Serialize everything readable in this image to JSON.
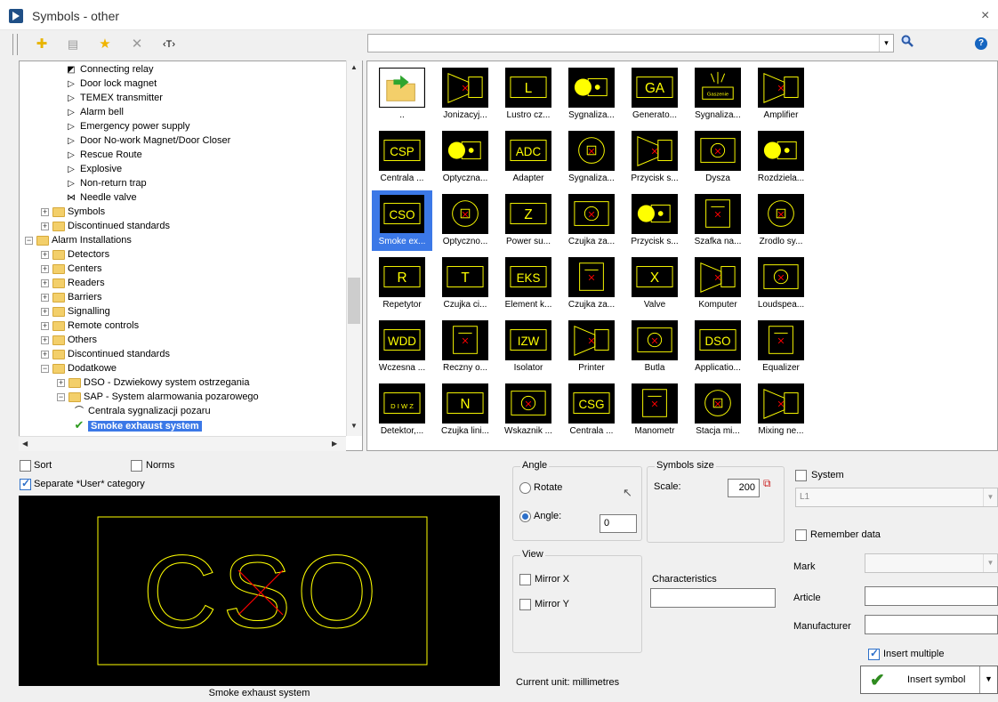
{
  "window": {
    "title": "Symbols - other",
    "close": "×"
  },
  "toolbar": {
    "add": "✚",
    "list": "▤",
    "favorite": "★",
    "remove": "✕",
    "text": "‹T›",
    "search_value": "",
    "dropdown": "▾",
    "help": "?"
  },
  "tree": [
    {
      "label": "Connecting relay",
      "icon": "relay-icon",
      "glyph": "◩",
      "indent": 5
    },
    {
      "label": "Door lock magnet",
      "icon": "symbol-icon",
      "glyph": "▷",
      "indent": 5
    },
    {
      "label": "TEMEX transmitter",
      "icon": "symbol-icon",
      "glyph": "▷",
      "indent": 5
    },
    {
      "label": "Alarm bell",
      "icon": "symbol-icon",
      "glyph": "▷",
      "indent": 5
    },
    {
      "label": "Emergency power supply",
      "icon": "symbol-icon",
      "glyph": "▷",
      "indent": 5
    },
    {
      "label": "Door No-work Magnet/Door Closer",
      "icon": "symbol-icon",
      "glyph": "▷",
      "indent": 5
    },
    {
      "label": "Rescue Route",
      "icon": "symbol-icon",
      "glyph": "▷",
      "indent": 5
    },
    {
      "label": "Explosive",
      "icon": "symbol-icon",
      "glyph": "▷",
      "indent": 5
    },
    {
      "label": "Non-return trap",
      "icon": "symbol-icon",
      "glyph": "▷",
      "indent": 5
    },
    {
      "label": "Needle valve",
      "icon": "valve-icon",
      "glyph": "⋈",
      "indent": 5
    },
    {
      "label": "Symbols",
      "folder": true,
      "exp": "+",
      "indent": 2
    },
    {
      "label": "Discontinued standards",
      "folder": true,
      "exp": "+",
      "indent": 2
    },
    {
      "label": "Alarm Installations",
      "folder": true,
      "exp": "−",
      "indent": 0
    },
    {
      "label": "Detectors",
      "folder": true,
      "exp": "+",
      "indent": 2
    },
    {
      "label": "Centers",
      "folder": true,
      "exp": "+",
      "indent": 2
    },
    {
      "label": "Readers",
      "folder": true,
      "exp": "+",
      "indent": 2
    },
    {
      "label": "Barriers",
      "folder": true,
      "exp": "+",
      "indent": 2
    },
    {
      "label": "Signalling",
      "folder": true,
      "exp": "+",
      "indent": 2
    },
    {
      "label": "Remote controls",
      "folder": true,
      "exp": "+",
      "indent": 2
    },
    {
      "label": "Others",
      "folder": true,
      "exp": "+",
      "indent": 2
    },
    {
      "label": "Discontinued standards",
      "folder": true,
      "exp": "+",
      "indent": 2
    },
    {
      "label": "Dodatkowe",
      "folder": true,
      "exp": "−",
      "indent": 2
    },
    {
      "label": "DSO - Dzwiekowy system ostrzegania",
      "folder": true,
      "exp": "+",
      "indent": 4
    },
    {
      "label": "SAP - System alarmowania pozarowego",
      "folder": true,
      "exp": "−",
      "indent": 4
    },
    {
      "label": "Centrala sygnalizacji pozaru",
      "icon": "line-icon",
      "glyph": "⌒",
      "indent": 6
    },
    {
      "label": "Smoke exhaust system",
      "icon": "check-icon",
      "glyph": "✔",
      "indent": 6,
      "selected": true
    }
  ],
  "grid": [
    [
      "..",
      "Jonizacyj...",
      "Lustro cz...",
      "Sygnaliza...",
      "Generato...",
      "Sygnaliza...",
      "Amplifier"
    ],
    [
      "Centrala ...",
      "Optyczna...",
      "Adapter",
      "Sygnaliza...",
      "Przycisk s...",
      "Dysza",
      "Rozdziela..."
    ],
    [
      "Smoke ex...",
      "Optyczno...",
      "Power su...",
      "Czujka za...",
      "Przycisk s...",
      "Szafka na...",
      "Zrodlo sy..."
    ],
    [
      "Repetytor",
      "Czujka ci...",
      "Element k...",
      "Czujka za...",
      "Valve",
      "Komputer",
      "Loudspea..."
    ],
    [
      "Wczesna ...",
      "Reczny o...",
      "Isolator",
      "Printer",
      "Butla",
      "Applicatio...",
      "Equalizer"
    ],
    [
      "Detektor,...",
      "Czujka lini...",
      "Wskaznik ...",
      "Centrala ...",
      "Manometr",
      "Stacja mi...",
      "Mixing ne..."
    ]
  ],
  "thumb_texts": {
    "0_4": "GA",
    "0_5": "Gaszenie",
    "1_0": "CSP",
    "1_2": "ADC",
    "2_0": "CSO",
    "2_2": "Z",
    "3_0": "R",
    "3_1": "T",
    "3_2": "EKS",
    "3_4": "X",
    "4_0": "WDD",
    "4_2": "IZW",
    "4_5": "DSO",
    "5_0": "D I W Z",
    "5_1": "N",
    "5_3": "CSG",
    "0_2": "L"
  },
  "options": {
    "sort": "Sort",
    "sort_checked": false,
    "norms": "Norms",
    "norms_checked": false,
    "separate": "Separate *User* category",
    "separate_checked": true
  },
  "preview": {
    "text": "CSO",
    "caption": "Smoke exhaust system"
  },
  "angle": {
    "title": "Angle",
    "rotate": "Rotate",
    "angle_label": "Angle:",
    "angle_value": "0",
    "selected": "angle"
  },
  "size": {
    "title": "Symbols size",
    "scale_label": "Scale:",
    "scale_value": "200"
  },
  "view": {
    "title": "View",
    "mirror_x": "Mirror X",
    "mirror_y": "Mirror Y"
  },
  "characteristics": {
    "label": "Characteristics",
    "value": ""
  },
  "system": {
    "label": "System",
    "checked": false,
    "value": "L1"
  },
  "remember": {
    "label": "Remember data",
    "checked": false
  },
  "fields": {
    "mark": "Mark",
    "article": "Article",
    "manufacturer": "Manufacturer"
  },
  "insert_multiple": {
    "label": "Insert multiple",
    "checked": true
  },
  "insert_button": "Insert symbol",
  "unit": "Current unit: millimetres",
  "colors": {
    "accent": "#3b78e7",
    "symbol": "#ffff00",
    "cross": "#ff0000"
  }
}
